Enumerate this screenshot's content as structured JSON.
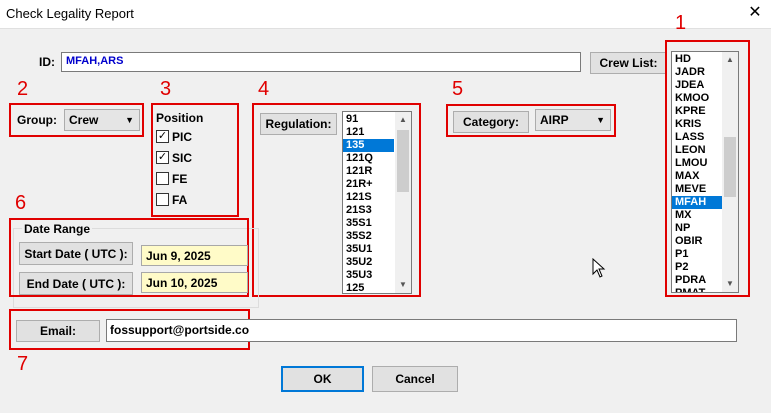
{
  "window": {
    "title": "Check Legality Report",
    "close": "✕"
  },
  "id_field": {
    "label": "ID:",
    "value": "MFAH,ARS"
  },
  "crew_list_button": "Crew List:",
  "crew_list": {
    "items": [
      "HD",
      "JADR",
      "JDEA",
      "KMOO",
      "KPRE",
      "KRIS",
      "LASS",
      "LEON",
      "LMOU",
      "MAX",
      "MEVE",
      "MFAH",
      "MX",
      "NP",
      "OBIR",
      "P1",
      "P2",
      "PDRA",
      "PMAT"
    ],
    "selected": "MFAH"
  },
  "group": {
    "label": "Group:",
    "value": "Crew"
  },
  "position": {
    "title": "Position",
    "items": [
      {
        "label": "PIC",
        "checked": true
      },
      {
        "label": "SIC",
        "checked": true
      },
      {
        "label": "FE",
        "checked": false
      },
      {
        "label": "FA",
        "checked": false
      }
    ]
  },
  "regulation": {
    "button": "Regulation:",
    "items": [
      "91",
      "121",
      "135",
      "121Q",
      "121R",
      "21R+",
      "121S",
      "21S3",
      "35S1",
      "35S2",
      "35U1",
      "35U2",
      "35U3",
      "125"
    ],
    "selected": "135"
  },
  "category": {
    "button": "Category:",
    "value": "AIRP"
  },
  "date_range": {
    "title": "Date Range",
    "start_label": "Start Date ( UTC ):",
    "start_value": "Jun 9, 2025",
    "end_label": "End Date ( UTC ):",
    "end_value": "Jun 10, 2025"
  },
  "email": {
    "button": "Email:",
    "value": "fossupport@portside.co"
  },
  "ok_button": "OK",
  "cancel_button": "Cancel",
  "annotations": [
    "1",
    "2",
    "3",
    "4",
    "5",
    "6",
    "7"
  ],
  "colors": {
    "annotation_red": "#e00000",
    "selection_blue": "#0078d7",
    "id_text_blue": "#0000cc",
    "date_yellow": "#fffbc8"
  }
}
